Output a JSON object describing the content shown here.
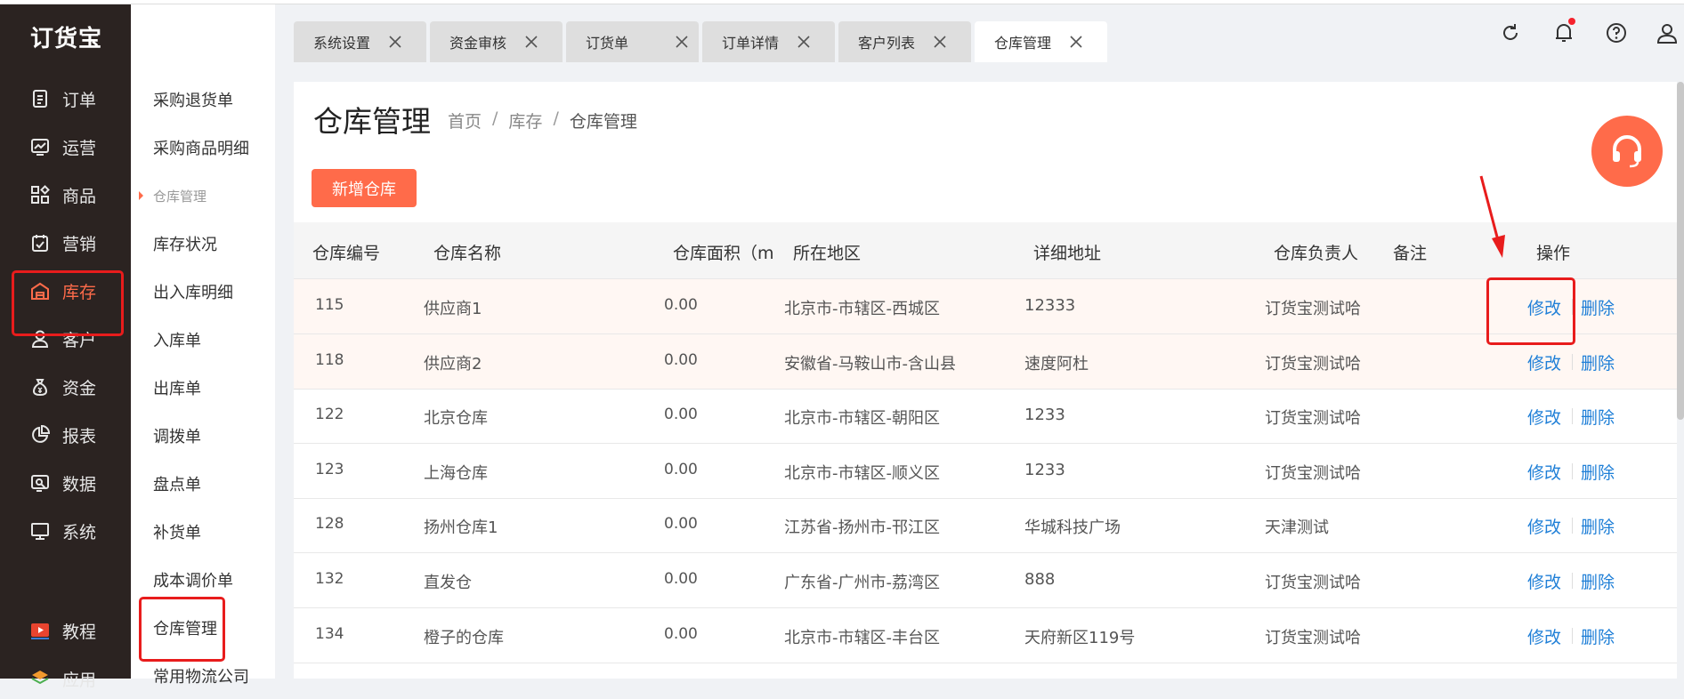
{
  "app": {
    "logo": "订货宝"
  },
  "sidebar": {
    "items": [
      {
        "label": "订单",
        "icon": "order-icon"
      },
      {
        "label": "运营",
        "icon": "operations-icon"
      },
      {
        "label": "商品",
        "icon": "goods-icon"
      },
      {
        "label": "营销",
        "icon": "marketing-icon"
      },
      {
        "label": "库存",
        "icon": "warehouse-icon",
        "active": true
      },
      {
        "label": "客户",
        "icon": "customer-icon"
      },
      {
        "label": "资金",
        "icon": "money-icon"
      },
      {
        "label": "报表",
        "icon": "report-icon"
      },
      {
        "label": "数据",
        "icon": "data-icon"
      },
      {
        "label": "系统",
        "icon": "system-icon"
      },
      {
        "label": "教程",
        "icon": "tutorial-icon"
      },
      {
        "label": "应用",
        "icon": "apps-icon"
      }
    ],
    "accent_color": "#ff6b4a"
  },
  "submenu": {
    "items": [
      {
        "label": "采购退货单"
      },
      {
        "label": "采购商品明细"
      },
      {
        "label": "仓库管理",
        "group": true
      },
      {
        "label": "库存状况"
      },
      {
        "label": "出入库明细"
      },
      {
        "label": "入库单"
      },
      {
        "label": "出库单"
      },
      {
        "label": "调拨单"
      },
      {
        "label": "盘点单"
      },
      {
        "label": "补货单"
      },
      {
        "label": "成本调价单"
      },
      {
        "label": "仓库管理",
        "active": true
      },
      {
        "label": "常用物流公司"
      }
    ]
  },
  "tabs": [
    {
      "label": "系统设置"
    },
    {
      "label": "资金审核"
    },
    {
      "label": "订货单"
    },
    {
      "label": "订单详情"
    },
    {
      "label": "客户列表"
    },
    {
      "label": "仓库管理",
      "active": true
    }
  ],
  "header_icons": [
    "refresh-icon",
    "bell-icon",
    "help-icon",
    "user-icon"
  ],
  "page": {
    "title": "仓库管理",
    "breadcrumb": [
      "首页",
      "库存",
      "仓库管理"
    ],
    "breadcrumb_sep": "/",
    "add_button": "新增仓库"
  },
  "table": {
    "columns": [
      "仓库编号",
      "仓库名称",
      "仓库面积（m",
      "所在地区",
      "详细地址",
      "仓库负责人",
      "备注",
      "操作"
    ],
    "rows": [
      {
        "id": "115",
        "name": "供应商1",
        "area": "0.00",
        "region": "北京市-市辖区-西城区",
        "address": "12333",
        "manager": "订货宝测试哈",
        "note": "",
        "edit": "修改",
        "delete": "删除"
      },
      {
        "id": "118",
        "name": "供应商2",
        "area": "0.00",
        "region": "安徽省-马鞍山市-含山县",
        "address": "速度阿杜",
        "manager": "订货宝测试哈",
        "note": "",
        "edit": "修改",
        "delete": "删除"
      },
      {
        "id": "122",
        "name": "北京仓库",
        "area": "0.00",
        "region": "北京市-市辖区-朝阳区",
        "address": "1233",
        "manager": "订货宝测试哈",
        "note": "",
        "edit": "修改",
        "delete": "删除"
      },
      {
        "id": "123",
        "name": "上海仓库",
        "area": "0.00",
        "region": "北京市-市辖区-顺义区",
        "address": "1233",
        "manager": "订货宝测试哈",
        "note": "",
        "edit": "修改",
        "delete": "删除"
      },
      {
        "id": "128",
        "name": "扬州仓库1",
        "area": "0.00",
        "region": "江苏省-扬州市-邗江区",
        "address": "华城科技广场",
        "manager": "天津测试",
        "note": "",
        "edit": "修改",
        "delete": "删除"
      },
      {
        "id": "132",
        "name": "直发仓",
        "area": "0.00",
        "region": "广东省-广州市-荔湾区",
        "address": "888",
        "manager": "订货宝测试哈",
        "note": "",
        "edit": "修改",
        "delete": "删除"
      },
      {
        "id": "134",
        "name": "橙子的仓库",
        "area": "0.00",
        "region": "北京市-市辖区-丰台区",
        "address": "天府新区119号",
        "manager": "订货宝测试哈",
        "note": "",
        "edit": "修改",
        "delete": "删除"
      }
    ]
  },
  "support_button": {
    "icon": "headset-icon"
  }
}
